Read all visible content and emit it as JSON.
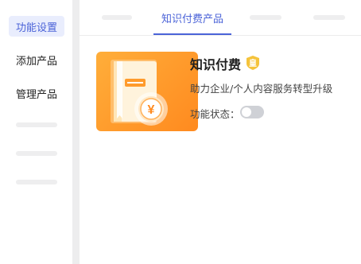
{
  "sidebar": {
    "items": [
      {
        "label": "功能设置",
        "active": true
      },
      {
        "label": "添加产品"
      },
      {
        "label": "管理产品"
      }
    ]
  },
  "tabs": {
    "active_label": "知识付费产品"
  },
  "product": {
    "title": "知识付费",
    "badge_icon": "crown-icon",
    "description": "助力企业/个人内容服务转型升级",
    "status_label": "功能状态：",
    "status_enabled": false,
    "thumbnail_icon": "book-yen-icon"
  },
  "colors": {
    "accent": "#4b63d8",
    "thumb_orange": "#ff9a2a",
    "badge_gold": "#f5c33b"
  }
}
